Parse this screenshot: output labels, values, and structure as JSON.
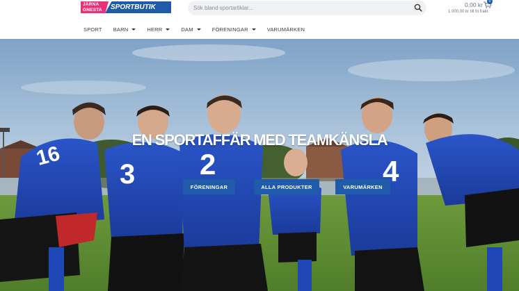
{
  "brand": {
    "logo_left": "JÄRNA GNESTA",
    "logo_right": "SPORTBUTIK",
    "colors": {
      "pink": "#e8327a",
      "blue": "#1f5ba8"
    }
  },
  "search": {
    "placeholder": "Sök bland sportartiklar...",
    "icon": "search-icon"
  },
  "cart": {
    "total": "0,00 kr",
    "count": "0",
    "free_shipping": "1 000,00 kr till fri frakt",
    "icon": "cart-icon"
  },
  "nav": {
    "items": [
      {
        "label": "SPORT",
        "dropdown": false
      },
      {
        "label": "BARN",
        "dropdown": true
      },
      {
        "label": "HERR",
        "dropdown": true
      },
      {
        "label": "DAM",
        "dropdown": true
      },
      {
        "label": "FÖRENINGAR",
        "dropdown": true
      },
      {
        "label": "VARUMÄRKEN",
        "dropdown": false
      }
    ]
  },
  "hero": {
    "title": "EN SPORTAFFÄR MED TEAMKÄNSLA",
    "buttons": [
      "FÖRENINGAR",
      "ALLA PRODUKTER",
      "VARUMÄRKEN"
    ],
    "jersey_numbers": [
      "16",
      "3",
      "2",
      "4"
    ]
  }
}
